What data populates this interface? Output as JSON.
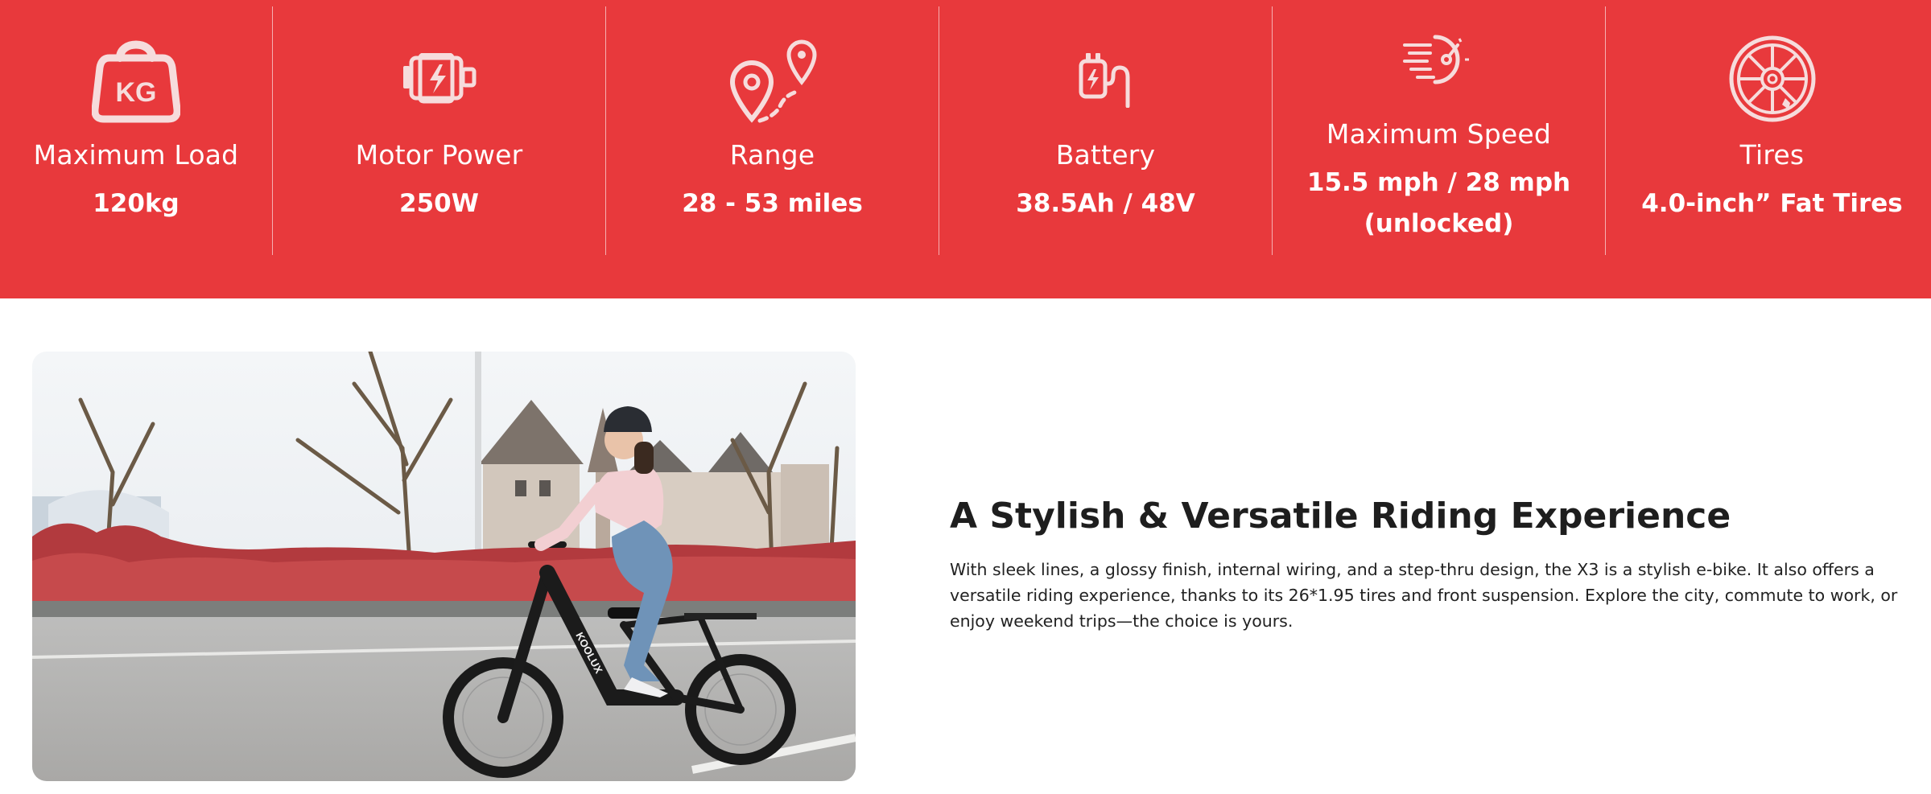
{
  "colors": {
    "band": "#e8393c",
    "spec_text": "#ffffff",
    "heading": "#1e1e1e",
    "body": "#222222"
  },
  "specs": [
    {
      "icon": "weight-kg-icon",
      "icon_text": "KG",
      "label": "Maximum Load",
      "value": "120kg"
    },
    {
      "icon": "motor-icon",
      "label": "Motor Power",
      "value": "250W"
    },
    {
      "icon": "route-pin-icon",
      "label": "Range",
      "value": "28 - 53 miles"
    },
    {
      "icon": "battery-plug-icon",
      "label": "Battery",
      "value": "38.5Ah / 48V"
    },
    {
      "icon": "speedometer-icon",
      "label": "Maximum Speed",
      "value_line1": "15.5 mph / 28 mph",
      "value_line2": "(unlocked)"
    },
    {
      "icon": "wheel-icon",
      "label": "Tires",
      "value": "4.0-inch” Fat Tires"
    }
  ],
  "feature": {
    "image": "woman-riding-ebike-photo",
    "bike_brand": "KOOLUX",
    "heading": "A Stylish & Versatile Riding Experience",
    "body": "With sleek lines, a glossy finish, internal wiring, and a step-thru design, the X3 is a stylish e-bike. It also offers a versatile riding experience, thanks to its 26*1.95 tires and front suspension. Explore the city, commute to work, or enjoy weekend trips—the choice is yours."
  }
}
